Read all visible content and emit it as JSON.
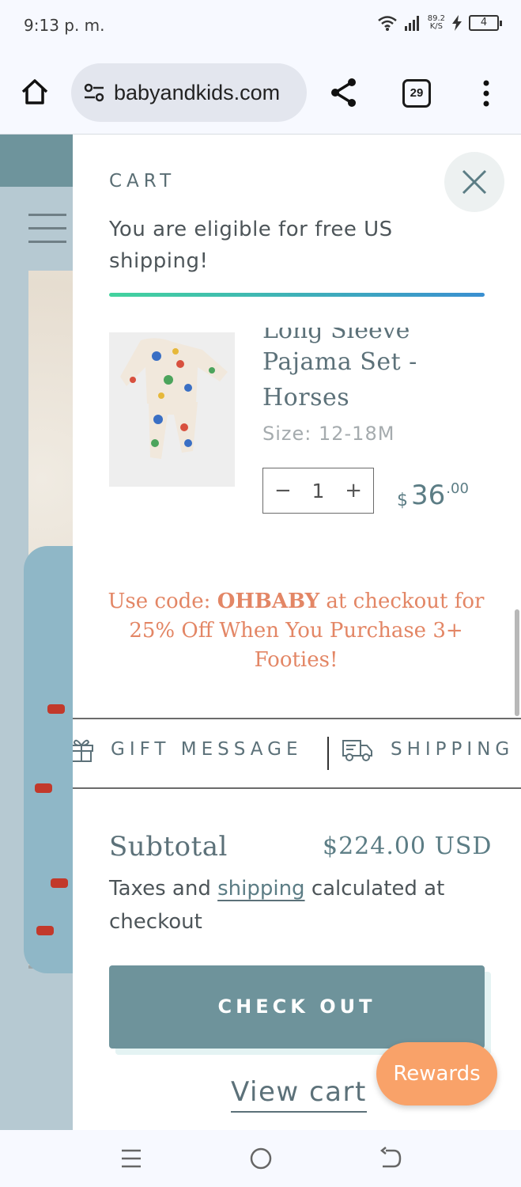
{
  "status_bar": {
    "time": "9:13 p. m.",
    "speed_value": "89.2",
    "speed_unit": "K/S",
    "battery": "4"
  },
  "browser": {
    "url": "babyandkids.com",
    "tab_count": "29"
  },
  "cart": {
    "title": "CART",
    "shipping_message": "You are eligible for free US shipping!",
    "shipping_progress": 1.0,
    "item": {
      "title_partial": "Long Sleeve",
      "title": "Pajama Set - Horses",
      "size": "Size: 12-18M",
      "quantity": "1",
      "price_currency": "$",
      "price_main": "36",
      "price_cents": ".00"
    },
    "promo": {
      "prefix": "Use code: ",
      "code": "OHBABY",
      "suffix": " at checkout for 25% Off When You Purchase 3+ Footies!"
    },
    "options": {
      "gift_message": "GIFT MESSAGE",
      "shipping": "SHIPPING"
    },
    "subtotal_label": "Subtotal",
    "subtotal_value": "$224.00 USD",
    "tax_note_before": "Taxes and ",
    "tax_note_link": "shipping",
    "tax_note_after": " calculated at checkout",
    "checkout_label": "CHECK OUT",
    "view_cart_label": "View cart"
  },
  "rewards_label": "Rewards",
  "colors": {
    "accent": "#6e939b",
    "promo": "#e38665",
    "rewards": "#f9a269"
  }
}
